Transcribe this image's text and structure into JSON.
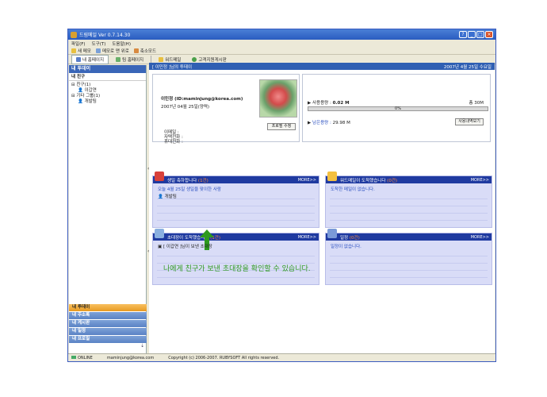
{
  "window": {
    "title": "드림메일 Ver 0.7.14.30"
  },
  "menu": [
    "파일(F)",
    "도구(T)",
    "도움말(H)"
  ],
  "toolbar": {
    "items": [
      "새 메모",
      "메모로 맨 위로",
      "축소모드"
    ]
  },
  "tabs": [
    "내 홈페이지",
    "팀 홈페이지",
    "워드메일",
    "고객지원게시판"
  ],
  "sidebar": {
    "header": "내 투데이",
    "sub": "내 친구",
    "tree": [
      {
        "label": "친구(1)",
        "level": 0
      },
      {
        "label": "이갑연",
        "level": 1
      },
      {
        "label": "기타 그룹(1)",
        "level": 0
      },
      {
        "label": "개발팀",
        "level": 1
      }
    ],
    "menu": [
      "내 투데이",
      "내 주소록",
      "내 게시판",
      "내 일정",
      "내 프로필"
    ]
  },
  "main": {
    "header_title": "[ 이민정 ]님의 투데이",
    "header_date": "2007년 4월 25일 수요일"
  },
  "profile": {
    "name": "이민정 (ID:maminjung@korea.com)",
    "date": "2007년 04월 25일(양력)",
    "labels": [
      "이메일 :",
      "자택전화 :",
      "휴대전화 :"
    ],
    "edit_label": "프로필 수정"
  },
  "usage": {
    "used_label": "사용용량 : ",
    "used_value": "0.02 M",
    "total": "총 30M",
    "percent": "0%",
    "percent_value": 0,
    "remain_label": "남은용량 : ",
    "remain_value": "29.98 M",
    "button": "사용내역보기"
  },
  "panels": [
    {
      "title": "생일 축하합니다",
      "count": "(1건)",
      "more": "MORE>>",
      "body": [
        "오늘 4월 25일 생일을 맞이한 사람",
        "개발팀"
      ]
    },
    {
      "title": "워드메일이 도착했습니다",
      "count": "(0건)",
      "more": "MORE>>",
      "body": [
        "도착한 메일이 없습니다."
      ]
    },
    {
      "title": "초대장이 도착했습니다",
      "count": "(1건)",
      "more": "MORE>>",
      "body": [
        "[ 이갑연 ]님이 보낸 초대장"
      ]
    },
    {
      "title": "일정",
      "count": "(0건)",
      "more": "MORE>>",
      "body": [
        "일정이 없습니다."
      ]
    }
  ],
  "statusbar": {
    "status": "ONLINE",
    "email": "maminjung@korea.com",
    "copyright": "Copyright (c) 2006-2007. RUBYSOFT All rights reserved."
  },
  "annotation": {
    "caption": "나에게 친구가 보낸 초대장을 확인할 수 있습니다.",
    "color": "#2e9a1e"
  }
}
